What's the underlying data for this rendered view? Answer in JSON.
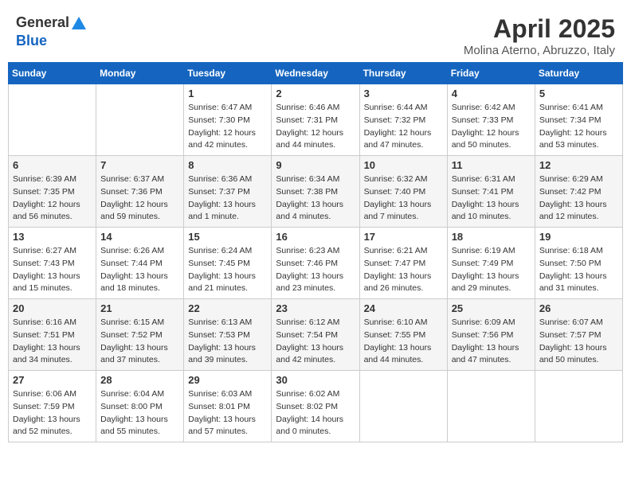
{
  "header": {
    "logo_general": "General",
    "logo_blue": "Blue",
    "month_title": "April 2025",
    "location": "Molina Aterno, Abruzzo, Italy"
  },
  "weekdays": [
    "Sunday",
    "Monday",
    "Tuesday",
    "Wednesday",
    "Thursday",
    "Friday",
    "Saturday"
  ],
  "weeks": [
    [
      null,
      null,
      {
        "day": "1",
        "sunrise": "6:47 AM",
        "sunset": "7:30 PM",
        "daylight": "12 hours and 42 minutes."
      },
      {
        "day": "2",
        "sunrise": "6:46 AM",
        "sunset": "7:31 PM",
        "daylight": "12 hours and 44 minutes."
      },
      {
        "day": "3",
        "sunrise": "6:44 AM",
        "sunset": "7:32 PM",
        "daylight": "12 hours and 47 minutes."
      },
      {
        "day": "4",
        "sunrise": "6:42 AM",
        "sunset": "7:33 PM",
        "daylight": "12 hours and 50 minutes."
      },
      {
        "day": "5",
        "sunrise": "6:41 AM",
        "sunset": "7:34 PM",
        "daylight": "12 hours and 53 minutes."
      }
    ],
    [
      {
        "day": "6",
        "sunrise": "6:39 AM",
        "sunset": "7:35 PM",
        "daylight": "12 hours and 56 minutes."
      },
      {
        "day": "7",
        "sunrise": "6:37 AM",
        "sunset": "7:36 PM",
        "daylight": "12 hours and 59 minutes."
      },
      {
        "day": "8",
        "sunrise": "6:36 AM",
        "sunset": "7:37 PM",
        "daylight": "13 hours and 1 minute."
      },
      {
        "day": "9",
        "sunrise": "6:34 AM",
        "sunset": "7:38 PM",
        "daylight": "13 hours and 4 minutes."
      },
      {
        "day": "10",
        "sunrise": "6:32 AM",
        "sunset": "7:40 PM",
        "daylight": "13 hours and 7 minutes."
      },
      {
        "day": "11",
        "sunrise": "6:31 AM",
        "sunset": "7:41 PM",
        "daylight": "13 hours and 10 minutes."
      },
      {
        "day": "12",
        "sunrise": "6:29 AM",
        "sunset": "7:42 PM",
        "daylight": "13 hours and 12 minutes."
      }
    ],
    [
      {
        "day": "13",
        "sunrise": "6:27 AM",
        "sunset": "7:43 PM",
        "daylight": "13 hours and 15 minutes."
      },
      {
        "day": "14",
        "sunrise": "6:26 AM",
        "sunset": "7:44 PM",
        "daylight": "13 hours and 18 minutes."
      },
      {
        "day": "15",
        "sunrise": "6:24 AM",
        "sunset": "7:45 PM",
        "daylight": "13 hours and 21 minutes."
      },
      {
        "day": "16",
        "sunrise": "6:23 AM",
        "sunset": "7:46 PM",
        "daylight": "13 hours and 23 minutes."
      },
      {
        "day": "17",
        "sunrise": "6:21 AM",
        "sunset": "7:47 PM",
        "daylight": "13 hours and 26 minutes."
      },
      {
        "day": "18",
        "sunrise": "6:19 AM",
        "sunset": "7:49 PM",
        "daylight": "13 hours and 29 minutes."
      },
      {
        "day": "19",
        "sunrise": "6:18 AM",
        "sunset": "7:50 PM",
        "daylight": "13 hours and 31 minutes."
      }
    ],
    [
      {
        "day": "20",
        "sunrise": "6:16 AM",
        "sunset": "7:51 PM",
        "daylight": "13 hours and 34 minutes."
      },
      {
        "day": "21",
        "sunrise": "6:15 AM",
        "sunset": "7:52 PM",
        "daylight": "13 hours and 37 minutes."
      },
      {
        "day": "22",
        "sunrise": "6:13 AM",
        "sunset": "7:53 PM",
        "daylight": "13 hours and 39 minutes."
      },
      {
        "day": "23",
        "sunrise": "6:12 AM",
        "sunset": "7:54 PM",
        "daylight": "13 hours and 42 minutes."
      },
      {
        "day": "24",
        "sunrise": "6:10 AM",
        "sunset": "7:55 PM",
        "daylight": "13 hours and 44 minutes."
      },
      {
        "day": "25",
        "sunrise": "6:09 AM",
        "sunset": "7:56 PM",
        "daylight": "13 hours and 47 minutes."
      },
      {
        "day": "26",
        "sunrise": "6:07 AM",
        "sunset": "7:57 PM",
        "daylight": "13 hours and 50 minutes."
      }
    ],
    [
      {
        "day": "27",
        "sunrise": "6:06 AM",
        "sunset": "7:59 PM",
        "daylight": "13 hours and 52 minutes."
      },
      {
        "day": "28",
        "sunrise": "6:04 AM",
        "sunset": "8:00 PM",
        "daylight": "13 hours and 55 minutes."
      },
      {
        "day": "29",
        "sunrise": "6:03 AM",
        "sunset": "8:01 PM",
        "daylight": "13 hours and 57 minutes."
      },
      {
        "day": "30",
        "sunrise": "6:02 AM",
        "sunset": "8:02 PM",
        "daylight": "14 hours and 0 minutes."
      },
      null,
      null,
      null
    ]
  ]
}
